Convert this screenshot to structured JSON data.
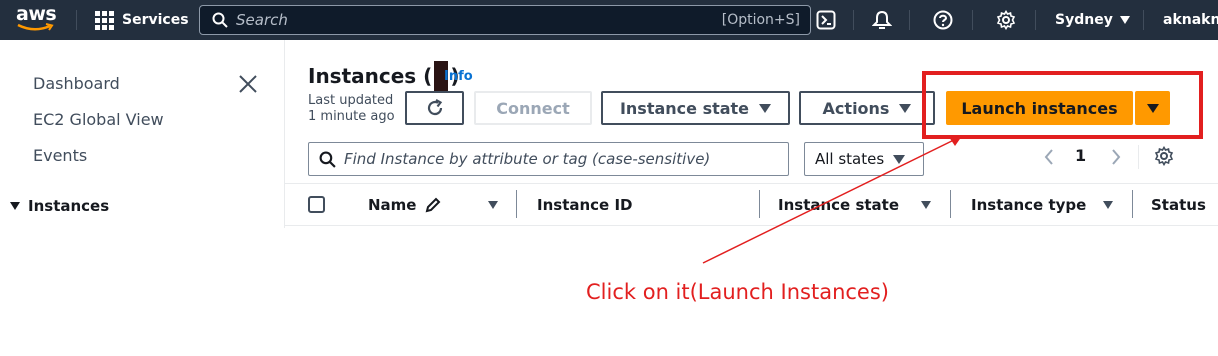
{
  "topnav": {
    "logo": "aws",
    "services_label": "Services",
    "search_placeholder": "Search",
    "search_shortcut": "[Option+S]",
    "icons": [
      "cloudshell-icon",
      "bell-icon",
      "help-icon",
      "gear-icon"
    ],
    "region": "Sydney",
    "account": "aknakn",
    "colors": {
      "bg": "#232f3e",
      "search_bg": "#0f1b2a"
    }
  },
  "sidebar": {
    "items": [
      {
        "label": "Dashboard"
      },
      {
        "label": "EC2 Global View"
      },
      {
        "label": "Events"
      }
    ],
    "section": "Instances"
  },
  "main": {
    "title": "Instances (",
    "title_close": ")",
    "info": "Info",
    "last_updated_line1": "Last updated",
    "last_updated_line2": "1 minute ago",
    "buttons": {
      "connect": "Connect",
      "instance_state": "Instance state",
      "actions": "Actions",
      "launch": "Launch instances"
    },
    "filter_placeholder": "Find Instance by attribute or tag (case-sensitive)",
    "states_select": "All states",
    "pagination": {
      "current_page": "1"
    },
    "columns": [
      "Name",
      "Instance ID",
      "Instance state",
      "Instance type",
      "Status"
    ],
    "colors": {
      "primary": "#ff9900",
      "link": "#0972d3"
    }
  },
  "annotation": {
    "text": "Click on it(Launch Instances)",
    "color": "#e21f1f"
  }
}
